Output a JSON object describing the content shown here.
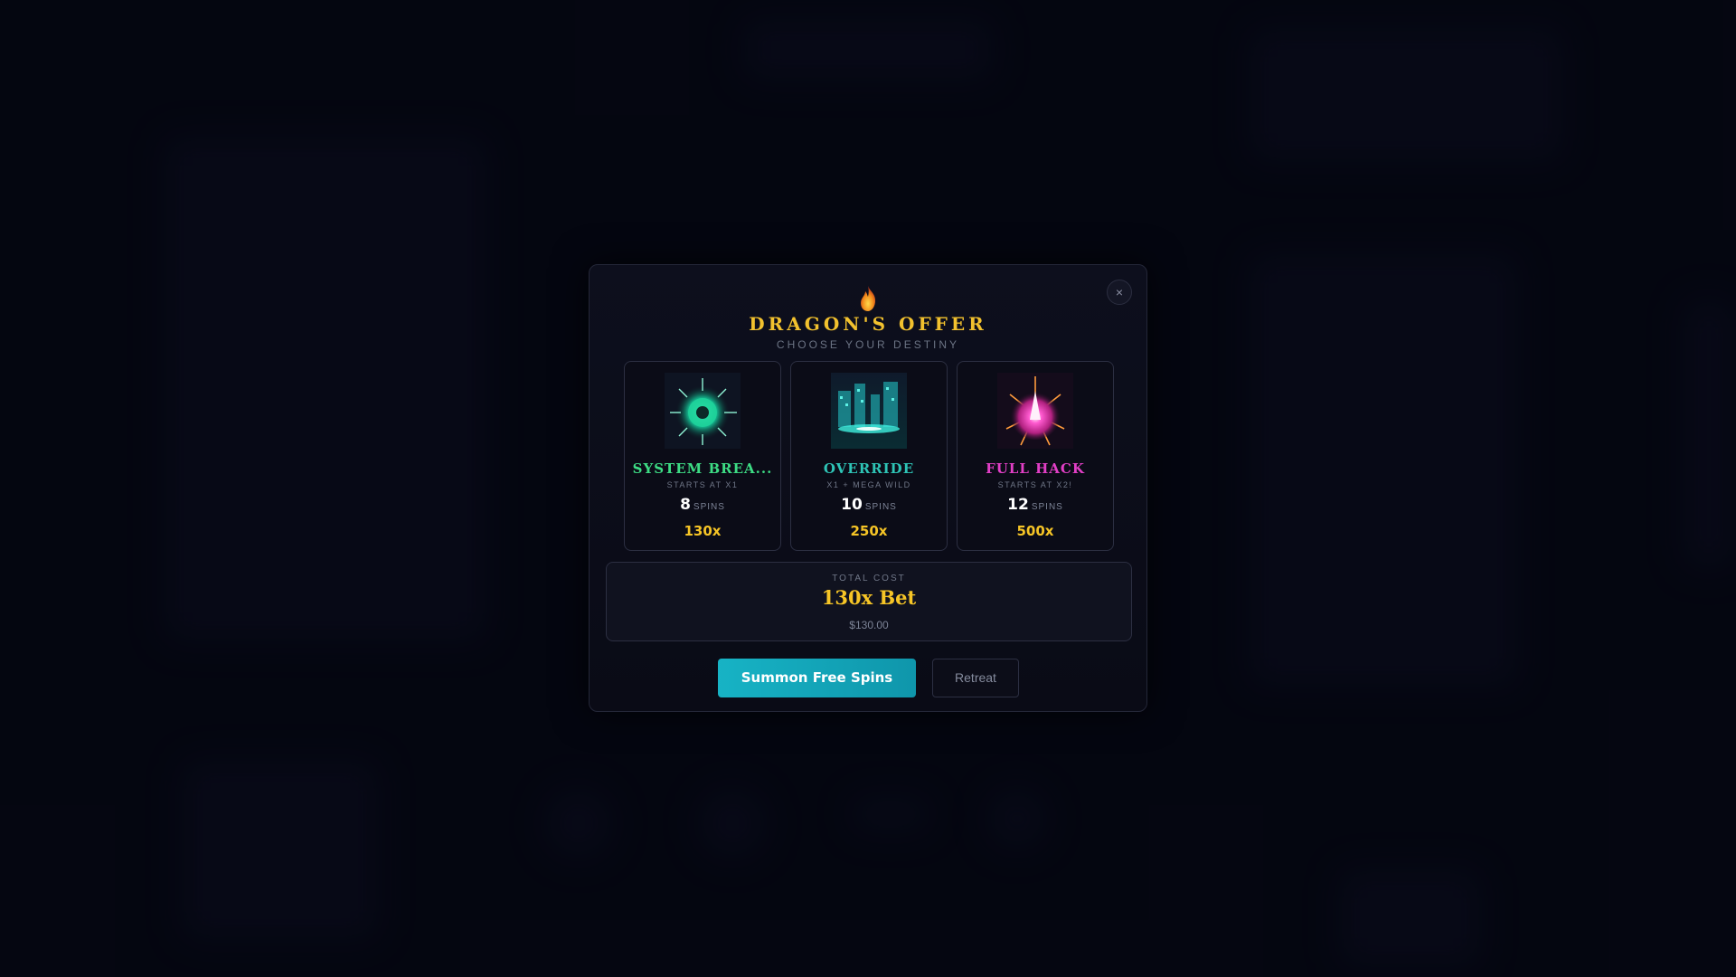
{
  "modal": {
    "title": "DRAGON'S OFFER",
    "subtitle": "CHOOSE YOUR DESTINY",
    "close_label": "×"
  },
  "options": [
    {
      "name": "SYSTEM BREA...",
      "subtitle": "STARTS AT X1",
      "spins": "8",
      "spins_label": "SPINS",
      "multiplier": "130x",
      "name_color": "#3ddc84",
      "icon": "green-burst-icon"
    },
    {
      "name": "OVERRIDE",
      "subtitle": "X1 + MEGA WILD",
      "spins": "10",
      "spins_label": "SPINS",
      "multiplier": "250x",
      "name_color": "#2ec4b6",
      "icon": "cyber-city-icon"
    },
    {
      "name": "FULL HACK",
      "subtitle": "STARTS AT X2!",
      "spins": "12",
      "spins_label": "SPINS",
      "multiplier": "500x",
      "name_color": "#e23fc6",
      "icon": "magenta-explosion-icon"
    }
  ],
  "cost": {
    "label": "TOTAL COST",
    "value": "130x Bet",
    "usd": "$130.00"
  },
  "actions": {
    "summon_label": "Summon Free Spins",
    "retreat_label": "Retreat"
  },
  "colors": {
    "accent_gold": "#f6c526",
    "button_teal": "#17b3c5"
  }
}
